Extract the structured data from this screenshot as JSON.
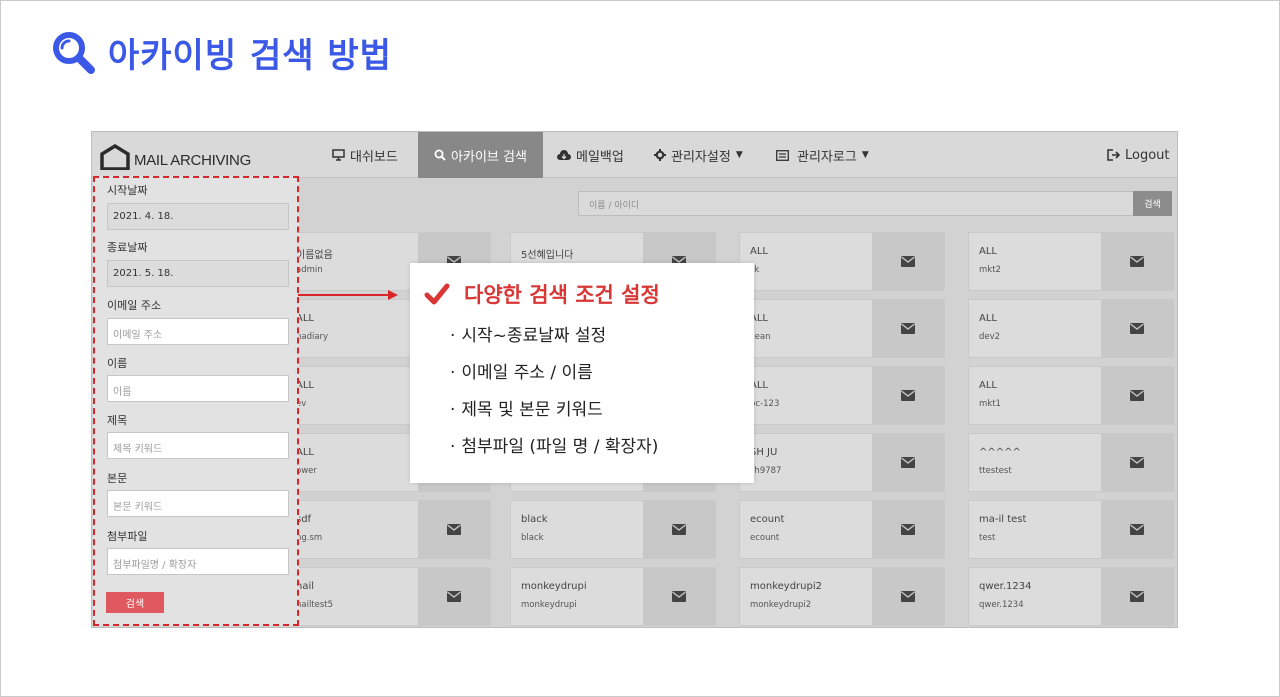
{
  "page": {
    "title": "아카이빙 검색 방법"
  },
  "app": {
    "brand": "MAIL ARCHIVING",
    "nav": [
      {
        "label": "대쉬보드",
        "icon": "monitor-icon"
      },
      {
        "label": "아카이브 검색",
        "icon": "search-icon",
        "active": true
      },
      {
        "label": "메일백업",
        "icon": "cloud-download-icon"
      },
      {
        "label": "관리자설정",
        "icon": "gear-icon",
        "dropdown": true
      },
      {
        "label": "관리자로그",
        "icon": "list-icon",
        "dropdown": true
      }
    ],
    "logout": "Logout",
    "search": {
      "placeholder": "이름 / 아이디",
      "button": "검색"
    }
  },
  "sidebar": {
    "start_label": "시작날짜",
    "start_value": "2021. 4. 18.",
    "end_label": "종료날짜",
    "end_value": "2021. 5. 18.",
    "email_label": "이메일 주소",
    "email_placeholder": "이메일 주소",
    "name_label": "이름",
    "name_placeholder": "이름",
    "subject_label": "제목",
    "subject_placeholder": "제목 키워드",
    "body_label": "본문",
    "body_placeholder": "본문 키워드",
    "attach_label": "첨부파일",
    "attach_placeholder": "첨부파일명 / 확장자",
    "search_button": "검색"
  },
  "cards": [
    [
      {
        "name": "이름없음",
        "id": "admin"
      },
      {
        "name": "5선혜입니다",
        "id": ""
      },
      {
        "name": "ALL",
        "id": "sk"
      },
      {
        "name": "ALL",
        "id": "mkt2"
      }
    ],
    [
      {
        "name": "ALL",
        "id": "nadiary"
      },
      {
        "name": "",
        "id": ""
      },
      {
        "name": "ALL",
        "id": "cean"
      },
      {
        "name": "ALL",
        "id": "dev2"
      }
    ],
    [
      {
        "name": "ALL",
        "id": "ev"
      },
      {
        "name": "",
        "id": ""
      },
      {
        "name": "ALL",
        "id": "bc-123"
      },
      {
        "name": "ALL",
        "id": "mkt1"
      }
    ],
    [
      {
        "name": "ALL",
        "id": "ower"
      },
      {
        "name": "",
        "id": ""
      },
      {
        "name": "SH JU",
        "id": "sh9787"
      },
      {
        "name": "^^^^^",
        "id": "ttestest"
      }
    ],
    [
      {
        "name": "sdf",
        "id": "ng.sm"
      },
      {
        "name": "black",
        "id": "black"
      },
      {
        "name": "ecount",
        "id": "ecount"
      },
      {
        "name": "ma-il test",
        "id": "test"
      }
    ],
    [
      {
        "name": "nail",
        "id": "nailtest5"
      },
      {
        "name": "monkeydrupi",
        "id": "monkeydrupi"
      },
      {
        "name": "monkeydrupi2",
        "id": "monkeydrupi2"
      },
      {
        "name": "qwer.1234",
        "id": "qwer.1234"
      }
    ]
  ],
  "callout": {
    "title": "다양한 검색 조건 설정",
    "bullet_mark": "·",
    "items": [
      "시작~종료날짜 설정",
      "이메일 주소 /  이름",
      "제목 및 본문 키워드",
      "첨부파일 (파일 명 / 확장자)"
    ]
  },
  "colors": {
    "title_blue": "#3b59e6",
    "accent_red": "#d9262b",
    "callout_red": "#d93636",
    "button_red": "#e0595f"
  }
}
